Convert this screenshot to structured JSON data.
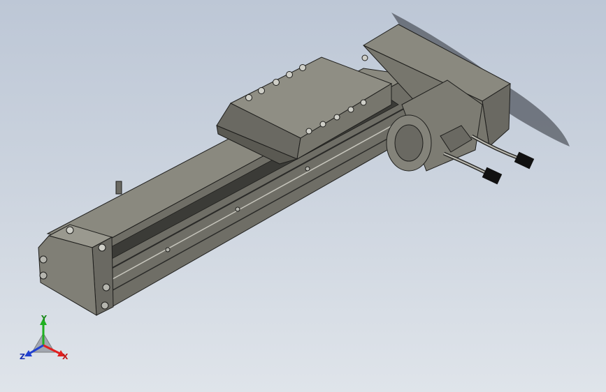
{
  "viewport": {
    "background_top": "#bdc7d6",
    "background_bottom": "#dfe4ea"
  },
  "model": {
    "body_color": "#7d7c73",
    "body_dark": "#5a5952",
    "body_light": "#a3a299",
    "edge_color": "#1e1e1c"
  },
  "triad": {
    "x_label": "X",
    "y_label": "Y",
    "z_label": "Z",
    "x_color": "#e02020",
    "y_color": "#20b020",
    "z_color": "#2040d0"
  }
}
